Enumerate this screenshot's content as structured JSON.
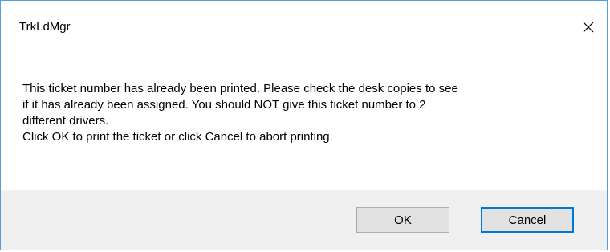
{
  "window": {
    "title": "TrkLdMgr",
    "close_icon": "close-icon"
  },
  "message": {
    "lines": [
      "This ticket number has already been printed. Please check the desk copies to see",
      "if it has already been assigned. You should NOT give this ticket number to 2",
      "different drivers.",
      "Click OK to print the ticket or click Cancel to abort printing."
    ]
  },
  "buttons": {
    "ok_label": "OK",
    "cancel_label": "Cancel"
  },
  "colors": {
    "window_border": "#5a9bd8",
    "footer_background": "#f0f0f0",
    "button_background": "#e1e1e1",
    "default_button_border": "#0078d7"
  }
}
